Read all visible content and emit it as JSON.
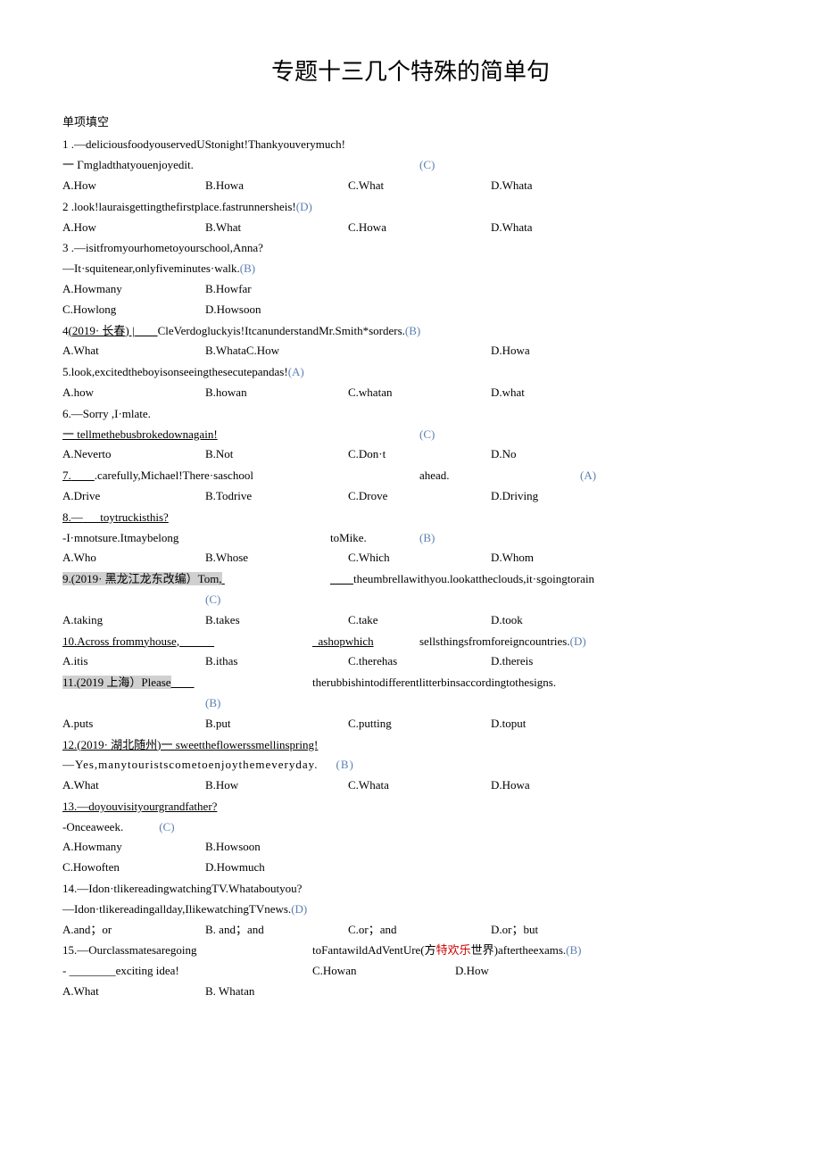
{
  "title": "专题十三几个特殊的简单句",
  "section": "单项填空",
  "q1": {
    "num": "1",
    "line1": " .—deliciousfoodyouservedUStonight!Thankyouverymuch!",
    "line2": "一 Γmgladthatyouenjoyedit.",
    "answer": "(C)",
    "a": "A.How",
    "b": "B.Howa",
    "c": "C.What",
    "d": "D.Whata"
  },
  "q2": {
    "num": "2",
    "line1": " .look!lauraisgettingthefirstplace.fastrunnersheis!",
    "answer": "(D)",
    "a": "A.How",
    "b": "B.What",
    "c": "C.Howa",
    "d": "D.Whata"
  },
  "q3": {
    "num": "3",
    "line1": " .—isitfromyourhometoyourschool,Anna?",
    "line2": "—It·squitenear,onlyfiveminutes·walk.",
    "answer": "(B)",
    "a": "A.Howmany",
    "b": "B.Howfar",
    "c": "C.Howlong",
    "d": "D.Howsoon"
  },
  "q4": {
    "prefix": "4",
    "src": "(2019· 长春) |",
    "line1": "CleVerdogluckyis!ItcanunderstandMr.Smith*sorders.",
    "answer": "(B)",
    "a": "A.What",
    "b": "B.WhataC.How",
    "d": "D.Howa"
  },
  "q5": {
    "line1": "5.look,excitedtheboyisonseeingthesecutepandas!",
    "answer": "(A)",
    "a": "A.how",
    "b": "B.howan",
    "c": "C.whatan",
    "d": "D.what"
  },
  "q6": {
    "line1": "6.—Sorry ,I·mlate.",
    "line2": "一   tellmethebusbrokedownagain!",
    "answer": "(C)",
    "a": "A.Neverto",
    "b": "B.Not",
    "c": "C.Don·t",
    "d": "D.No"
  },
  "q7": {
    "prefix": "7.",
    "line1": ".carefully,Michael!There·saschool",
    "line1b": "ahead.",
    "answer": "(A)",
    "a": "A.Drive",
    "b": "B.Todrive",
    "c": "C.Drove",
    "d": "D.Driving"
  },
  "q8": {
    "prefix": "8.—",
    "line1": "toytruckisthis?",
    "line2": "-I·mnotsure.Itmaybelong",
    "line2b": "toMike.",
    "answer": "(B)",
    "a": "A.Who",
    "b": "B.Whose",
    "c": "C.Which",
    "d": "D.Whom"
  },
  "q9": {
    "src": "9.(2019· 黑龙江龙东改编）Tom,",
    "line1": "theumbrellawithyou.lookattheclouds,it·sgoingtorain",
    "answer": "(C)",
    "a": "A.taking",
    "b": "B.takes",
    "c": "C.take",
    "d": "D.took"
  },
  "q10": {
    "prefix": "10.Across frommyhouse,",
    "line1": "_ashopwhich",
    "line1b": "sellsthingsfromforeigncountries.",
    "answer": "(D)",
    "a": "A.itis",
    "b": "B.ithas",
    "c": "C.therehas",
    "d": "D.thereis"
  },
  "q11": {
    "src": "11.(2019 上海）Please",
    "line1": "therubbishintodifferentlitterbinsaccordingtothesigns.",
    "answer": "(B)",
    "a": "A.puts",
    "b": "B.put",
    "c": "C.putting",
    "d": "D.toput"
  },
  "q12": {
    "src": "12.(2019· 湖北随州)",
    "line1": "一 sweettheflowerssmellinspring!",
    "line2": "—Yes,manytouristscometoenjoythemeveryday.",
    "answer": "(B)",
    "a": "A.What",
    "b": "B.How",
    "c": "C.Whata",
    "d": "D.Howa"
  },
  "q13": {
    "line1": "13.—doyouvisityourgrandfather?",
    "line2": "-Onceaweek.",
    "answer": "(C)",
    "a": "A.Howmany",
    "b": "B.Howsoon",
    "c": "C.Howoften",
    "d": "D.Howmuch"
  },
  "q14": {
    "line1": "14.—Idon·tlikereadingwatchingTV.Whataboutyou?",
    "line2": "—Idon·tlikereadingallday,IlikewatchingTVnews.",
    "answer": "(D)",
    "a": "A.and；or",
    "b": "B. and；and",
    "c": "C.or；and",
    "d": "D.or；but"
  },
  "q15": {
    "line1": "15.—Ourclassmatesaregoing",
    "line1b": "toFantawildAdVentUre(方",
    "line1c": "特欢乐",
    "line1d": "世界)aftertheexams.",
    "answer": "(B)",
    "line2": "- ________exciting idea!",
    "a": "A.What",
    "b": "B. Whatan",
    "c": "C.Howan",
    "d": "D.How"
  }
}
